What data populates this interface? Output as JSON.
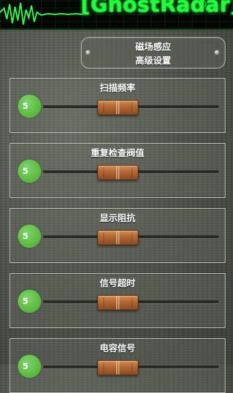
{
  "header": {
    "logo_text": "GhostRadar",
    "registered_mark": "R"
  },
  "advanced": {
    "line1": "磁场感应",
    "line2": "高级设置"
  },
  "settings": [
    {
      "title": "扫描频率",
      "value": "5",
      "slider_fraction": 0.4
    },
    {
      "title": "重复检查阀值",
      "value": "5",
      "slider_fraction": 0.4
    },
    {
      "title": "显示阻抗",
      "value": "5",
      "slider_fraction": 0.4
    },
    {
      "title": "信号超时",
      "value": "5",
      "slider_fraction": 0.4
    },
    {
      "title": "电容信号",
      "value": "5",
      "slider_fraction": 0.4
    }
  ],
  "colors": {
    "logo_green": "#1cff3a",
    "badge_green": "#5fbf45",
    "thumb_orange": "#b56b36"
  }
}
